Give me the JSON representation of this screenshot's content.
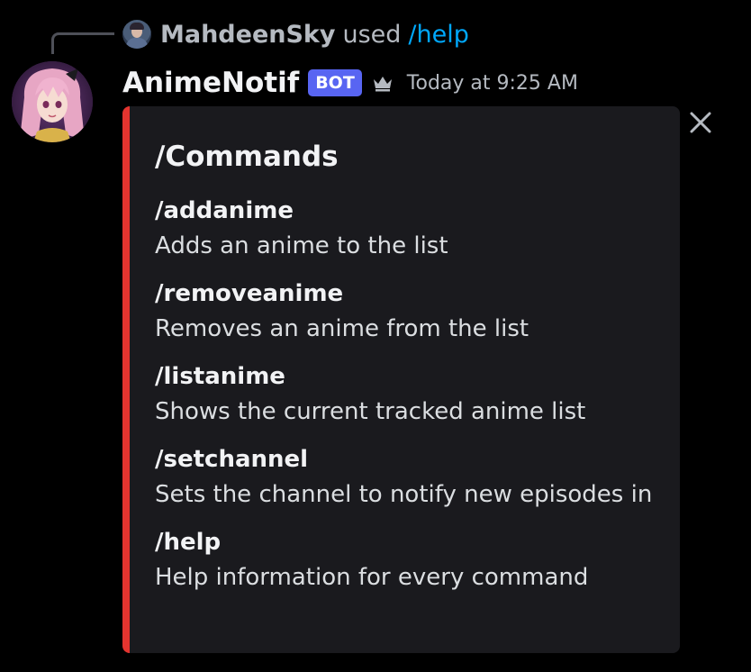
{
  "reply": {
    "username": "MahdeenSky",
    "used_text": "used",
    "command": "/help"
  },
  "message": {
    "username": "AnimeNotif",
    "bot_tag": "BOT",
    "timestamp": "Today at 9:25 AM"
  },
  "embed": {
    "accent_color": "#e3342f",
    "title": "/Commands",
    "fields": [
      {
        "name": "/addanime",
        "value": "Adds an anime to the list"
      },
      {
        "name": "/removeanime",
        "value": "Removes an anime from the list"
      },
      {
        "name": "/listanime",
        "value": "Shows the current tracked anime list"
      },
      {
        "name": "/setchannel",
        "value": "Sets the channel to notify new episodes in"
      },
      {
        "name": "/help",
        "value": "Help information for every command"
      }
    ]
  },
  "icons": {
    "crown": "crown-icon",
    "close": "close-icon"
  },
  "colors": {
    "background": "#000000",
    "bot_tag": "#5865f2",
    "link": "#00a8fc"
  }
}
